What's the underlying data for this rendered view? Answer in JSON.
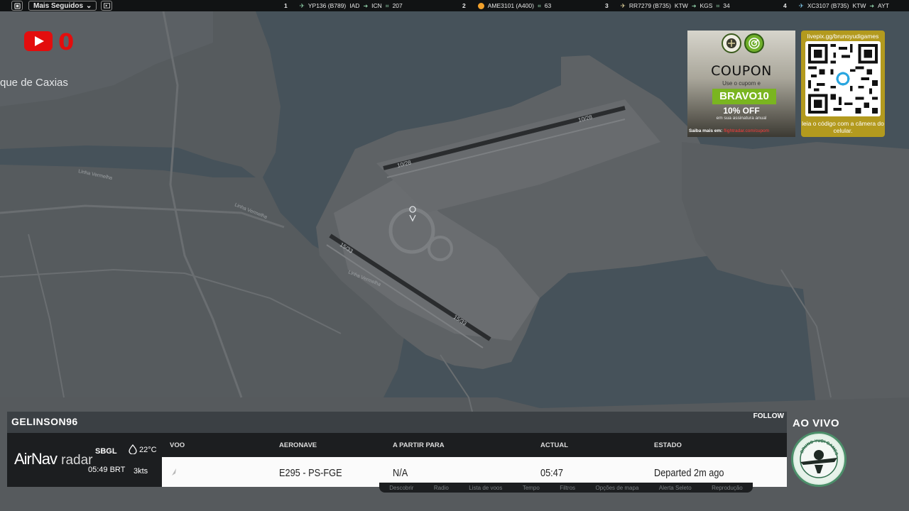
{
  "topbar": {
    "following_label": "Mais Seguidos",
    "flights": [
      {
        "rank": "1",
        "callsign": "YP136 (B789)",
        "from": "IAD",
        "to": "ICN",
        "count": "207"
      },
      {
        "rank": "2",
        "callsign": "AME3101 (A400)",
        "from": "",
        "to": "",
        "count": "63"
      },
      {
        "rank": "3",
        "callsign": "RR7279 (B735)",
        "from": "KTW",
        "to": "KGS",
        "count": "34"
      },
      {
        "rank": "4",
        "callsign": "XC3107 (B735)",
        "from": "KTW",
        "to": "AYT",
        "count": ""
      }
    ]
  },
  "overlay": {
    "youtube_count": "0",
    "city_label": "que de Caxias"
  },
  "map_labels": {
    "runway_top_a": "10/28",
    "runway_top_b": "10/28",
    "runway_bottom_a": "15/33",
    "runway_bottom_b": "15/33",
    "street_1": "Linha Vermelha",
    "street_2": "Linha Vermelha",
    "street_3": "Linha Vermelha"
  },
  "coupon_ad": {
    "title": "COUPON",
    "use_text": "Use o cupom e",
    "code": "BRAVO10",
    "discount": "10% OFF",
    "discount_sub": "em sua assinatura anual",
    "link_prefix": "Saiba mais em:",
    "link": "flightradar.com/cupom"
  },
  "qr_ad": {
    "url": "livepix.gg/brunoyudigames",
    "caption": "leia o código com a câmera do celular."
  },
  "flight_panel": {
    "username": "GELINSON96",
    "follow_label": "FOLLOW",
    "brand_a": "AirNav",
    "brand_b": "radar",
    "airport_code": "SBGL",
    "airport_time": "05:49 BRT",
    "temperature": "22°C",
    "wind": "3kts",
    "columns": {
      "flight": "VOO",
      "aircraft": "AERONAVE",
      "from_to": "A PARTIR PARA",
      "actual": "ACTUAL",
      "status": "ESTADO"
    },
    "row": {
      "aircraft": "E295 - PS-FGE",
      "from_to": "N/A",
      "actual": "05:47",
      "status": "Departed 2m ago"
    }
  },
  "bottom_menu": [
    "Descobrir",
    "Radio",
    "Lista de voos",
    "Tempo",
    "Filtros",
    "Opções de mapa",
    "Alerta Seleto",
    "Reprodução"
  ],
  "live": {
    "label": "AO VIVO",
    "badge_text": "BRUNO YUDI GAMES"
  }
}
